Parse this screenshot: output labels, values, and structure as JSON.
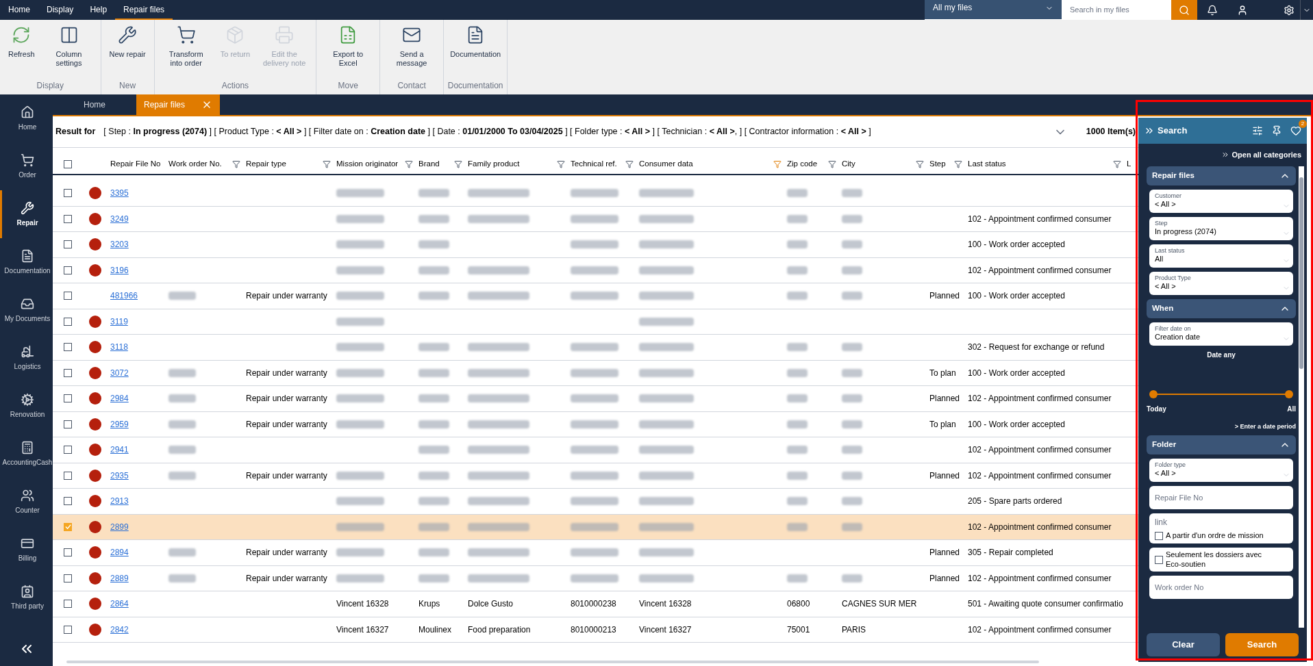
{
  "menu": [
    {
      "label": "Home",
      "selected": false
    },
    {
      "label": "Display",
      "selected": false
    },
    {
      "label": "Help",
      "selected": false
    },
    {
      "label": "Repair files",
      "selected": true
    }
  ],
  "top_right": {
    "scope": "All my files",
    "search_placeholder": "Search in my files"
  },
  "ribbon": [
    {
      "group": "Display",
      "buttons": [
        {
          "label": "Refresh",
          "disabled": false
        },
        {
          "label": "Column settings",
          "disabled": false
        }
      ]
    },
    {
      "group": "New",
      "buttons": [
        {
          "label": "New repair",
          "disabled": false
        }
      ]
    },
    {
      "group": "Actions",
      "buttons": [
        {
          "label": "Transform into order",
          "disabled": false
        },
        {
          "label": "To return",
          "disabled": true
        },
        {
          "label": "Edit the delivery note",
          "disabled": true
        }
      ]
    },
    {
      "group": "Move",
      "buttons": [
        {
          "label": "Export to Excel",
          "disabled": false
        }
      ]
    },
    {
      "group": "Contact",
      "buttons": [
        {
          "label": "Send a message",
          "disabled": false
        }
      ]
    },
    {
      "group": "Documentation",
      "buttons": [
        {
          "label": "Documentation",
          "disabled": false
        }
      ]
    }
  ],
  "doc_tabs": [
    {
      "label": "Home",
      "selected": false
    },
    {
      "label": "Repair files",
      "selected": true
    }
  ],
  "sidebar": [
    {
      "label": "Home",
      "selected": false
    },
    {
      "label": "Order",
      "selected": false
    },
    {
      "label": "Repair",
      "selected": true
    },
    {
      "label": "Documentation",
      "selected": false
    },
    {
      "label": "My Documents",
      "selected": false
    },
    {
      "label": "Logistics",
      "selected": false
    },
    {
      "label": "Renovation",
      "selected": false
    },
    {
      "label": "AccountingCash",
      "selected": false
    },
    {
      "label": "Counter",
      "selected": false
    },
    {
      "label": "Billing",
      "selected": false
    },
    {
      "label": "Third party",
      "selected": false
    }
  ],
  "filter_summary": {
    "label": "Result for",
    "text": "[ Step : **In progress (2074)** ]  [ Product Type : **< All >** ]  [ Filter date on : **Creation date** ]  [ Date : **01/01/2000 To 03/04/2025** ]  [ Folder type : **< All >** ]  [ Technician : **< All >**, ]  [ Contractor information : **< All >** ]",
    "count": "1000 Item(s)"
  },
  "table": {
    "all_selected": false,
    "columns": [
      {
        "label": "Repair File No"
      },
      {
        "label": "Work order No.",
        "filtered": false
      },
      {
        "label": "Repair type",
        "filtered": false
      },
      {
        "label": "Mission originator",
        "filtered": false
      },
      {
        "label": "Brand",
        "filtered": false
      },
      {
        "label": "Family product",
        "filtered": false
      },
      {
        "label": "Technical ref.",
        "filtered": false
      },
      {
        "label": "Consumer data",
        "filtered": true
      },
      {
        "label": "Zip code",
        "filtered": false
      },
      {
        "label": "City",
        "filtered": false
      },
      {
        "label": "Step",
        "filtered": false
      },
      {
        "label": "Last status",
        "filtered": false
      },
      {
        "label": "L"
      }
    ],
    "rows": [
      {
        "file_no": "3395",
        "alert": true,
        "selected": false,
        "mission": {
          "kind": "blurred"
        },
        "brand": {
          "kind": "blurred"
        },
        "family": {
          "kind": "blurred"
        },
        "tech_ref": {
          "kind": "blurred"
        },
        "consumer": {
          "kind": "blurred"
        },
        "zip": {
          "kind": "blurred"
        },
        "city": {
          "kind": "blurred"
        }
      },
      {
        "file_no": "3249",
        "alert": true,
        "selected": false,
        "mission": {
          "kind": "blurred"
        },
        "brand": {
          "kind": "blurred"
        },
        "family": {
          "kind": "blurred"
        },
        "tech_ref": {
          "kind": "blurred"
        },
        "consumer": {
          "kind": "blurred"
        },
        "zip": {
          "kind": "blurred"
        },
        "city": {
          "kind": "blurred"
        },
        "status": "102 - Appointment confirmed consumer"
      },
      {
        "file_no": "3203",
        "alert": true,
        "selected": false,
        "mission": {
          "kind": "blurred"
        },
        "brand": {
          "kind": "blurred"
        },
        "tech_ref": {
          "kind": "blurred"
        },
        "consumer": {
          "kind": "blurred"
        },
        "zip": {
          "kind": "blurred"
        },
        "city": {
          "kind": "blurred"
        },
        "status": "100 - Work order accepted"
      },
      {
        "file_no": "3196",
        "alert": true,
        "selected": false,
        "mission": {
          "kind": "blurred"
        },
        "brand": {
          "kind": "blurred"
        },
        "family": {
          "kind": "blurred"
        },
        "tech_ref": {
          "kind": "blurred"
        },
        "consumer": {
          "kind": "blurred"
        },
        "zip": {
          "kind": "blurred"
        },
        "city": {
          "kind": "blurred"
        },
        "status": "102 - Appointment confirmed consumer"
      },
      {
        "file_no": "481966",
        "alert": false,
        "selected": false,
        "work_order": {
          "kind": "blurred"
        },
        "repair_type": "Repair under warranty",
        "mission": {
          "kind": "blurred"
        },
        "brand": {
          "kind": "blurred"
        },
        "family": {
          "kind": "blurred"
        },
        "tech_ref": {
          "kind": "blurred"
        },
        "consumer": {
          "kind": "blurred"
        },
        "zip": {
          "kind": "blurred"
        },
        "city": {
          "kind": "blurred"
        },
        "step": "Planned",
        "status": "100 - Work order accepted"
      },
      {
        "file_no": "3119",
        "alert": true,
        "selected": false,
        "mission": {
          "kind": "blurred"
        },
        "consumer": {
          "kind": "blurred"
        }
      },
      {
        "file_no": "3118",
        "alert": true,
        "selected": false,
        "mission": {
          "kind": "blurred"
        },
        "brand": {
          "kind": "blurred"
        },
        "family": {
          "kind": "blurred"
        },
        "tech_ref": {
          "kind": "blurred"
        },
        "consumer": {
          "kind": "blurred"
        },
        "zip": {
          "kind": "blurred"
        },
        "city": {
          "kind": "blurred"
        },
        "status": "302 - Request for exchange or refund"
      },
      {
        "file_no": "3072",
        "alert": true,
        "selected": false,
        "work_order": {
          "kind": "blurred"
        },
        "repair_type": "Repair under warranty",
        "mission": {
          "kind": "blurred"
        },
        "brand": {
          "kind": "blurred"
        },
        "family": {
          "kind": "blurred"
        },
        "tech_ref": {
          "kind": "blurred"
        },
        "consumer": {
          "kind": "blurred"
        },
        "zip": {
          "kind": "blurred"
        },
        "city": {
          "kind": "blurred"
        },
        "step": "To plan",
        "status": "100 - Work order accepted"
      },
      {
        "file_no": "2984",
        "alert": true,
        "selected": false,
        "work_order": {
          "kind": "blurred"
        },
        "repair_type": "Repair under warranty",
        "mission": {
          "kind": "blurred"
        },
        "brand": {
          "kind": "blurred"
        },
        "family": {
          "kind": "blurred"
        },
        "tech_ref": {
          "kind": "blurred"
        },
        "consumer": {
          "kind": "blurred"
        },
        "zip": {
          "kind": "blurred"
        },
        "city": {
          "kind": "blurred"
        },
        "step": "Planned",
        "status": "102 - Appointment confirmed consumer"
      },
      {
        "file_no": "2959",
        "alert": true,
        "selected": false,
        "work_order": {
          "kind": "blurred"
        },
        "repair_type": "Repair under warranty",
        "mission": {
          "kind": "blurred"
        },
        "brand": {
          "kind": "blurred"
        },
        "family": {
          "kind": "blurred"
        },
        "tech_ref": {
          "kind": "blurred"
        },
        "consumer": {
          "kind": "blurred"
        },
        "zip": {
          "kind": "blurred"
        },
        "city": {
          "kind": "blurred"
        },
        "step": "To plan",
        "status": "100 - Work order accepted"
      },
      {
        "file_no": "2941",
        "alert": true,
        "selected": false,
        "work_order": {
          "kind": "blurred"
        },
        "brand": {
          "kind": "blurred"
        },
        "family": {
          "kind": "blurred"
        },
        "tech_ref": {
          "kind": "blurred"
        },
        "consumer": {
          "kind": "blurred"
        },
        "zip": {
          "kind": "blurred"
        },
        "city": {
          "kind": "blurred"
        },
        "status": "102 - Appointment confirmed consumer"
      },
      {
        "file_no": "2935",
        "alert": true,
        "selected": false,
        "work_order": {
          "kind": "blurred"
        },
        "repair_type": "Repair under warranty",
        "mission": {
          "kind": "blurred"
        },
        "brand": {
          "kind": "blurred"
        },
        "family": {
          "kind": "blurred"
        },
        "tech_ref": {
          "kind": "blurred"
        },
        "consumer": {
          "kind": "blurred"
        },
        "zip": {
          "kind": "blurred"
        },
        "city": {
          "kind": "blurred"
        },
        "step": "Planned",
        "status": "102 - Appointment confirmed consumer"
      },
      {
        "file_no": "2913",
        "alert": true,
        "selected": false,
        "mission": {
          "kind": "blurred"
        },
        "brand": {
          "kind": "blurred"
        },
        "family": {
          "kind": "blurred"
        },
        "tech_ref": {
          "kind": "blurred"
        },
        "consumer": {
          "kind": "blurred"
        },
        "zip": {
          "kind": "blurred"
        },
        "city": {
          "kind": "blurred"
        },
        "status": "205 - Spare parts ordered"
      },
      {
        "file_no": "2899",
        "alert": true,
        "selected": true,
        "mission": {
          "kind": "blurred"
        },
        "brand": {
          "kind": "blurred"
        },
        "family": {
          "kind": "blurred"
        },
        "tech_ref": {
          "kind": "blurred"
        },
        "consumer": {
          "kind": "blurred"
        },
        "zip": {
          "kind": "blurred"
        },
        "city": {
          "kind": "blurred"
        },
        "status": "102 - Appointment confirmed consumer"
      },
      {
        "file_no": "2894",
        "alert": true,
        "selected": false,
        "work_order": {
          "kind": "blurred"
        },
        "repair_type": "Repair under warranty",
        "mission": {
          "kind": "blurred"
        },
        "brand": {
          "kind": "blurred"
        },
        "family": {
          "kind": "blurred"
        },
        "tech_ref": {
          "kind": "blurred"
        },
        "consumer": {
          "kind": "blurred"
        },
        "step": "Planned",
        "status": "305 - Repair completed"
      },
      {
        "file_no": "2889",
        "alert": true,
        "selected": false,
        "work_order": {
          "kind": "blurred"
        },
        "repair_type": "Repair under warranty",
        "mission": {
          "kind": "blurred"
        },
        "brand": {
          "kind": "blurred"
        },
        "family": {
          "kind": "blurred"
        },
        "tech_ref": {
          "kind": "blurred"
        },
        "consumer": {
          "kind": "blurred"
        },
        "zip": {
          "kind": "blurred"
        },
        "city": {
          "kind": "blurred"
        },
        "step": "Planned",
        "status": "102 - Appointment confirmed consumer"
      },
      {
        "file_no": "2864",
        "alert": true,
        "selected": false,
        "mission": "Vincent 16328",
        "brand": "Krups",
        "family": "Dolce Gusto",
        "tech_ref": "8010000238",
        "consumer": "Vincent 16328",
        "zip": "06800",
        "city": "CAGNES SUR MER",
        "status": "501 - Awaiting quote consumer confirmatio"
      },
      {
        "file_no": "2842",
        "alert": true,
        "selected": false,
        "mission": "Vincent 16327",
        "brand": "Moulinex",
        "family": "Food preparation",
        "tech_ref": "8010000213",
        "consumer": "Vincent 16327",
        "zip": "75001",
        "city": "PARIS",
        "status": "102 - Appointment confirmed consumer"
      }
    ]
  },
  "search_panel": {
    "highlighted": true,
    "title": "Search",
    "badge": "2",
    "open_all": "Open all categories",
    "sections": [
      {
        "title": "Repair files",
        "expanded": true,
        "items": [
          {
            "kind": "select",
            "label": "Customer",
            "value": "< All >"
          },
          {
            "kind": "select",
            "label": "Step",
            "value": "In progress (2074)"
          },
          {
            "kind": "select",
            "label": "Last status",
            "value": "All"
          },
          {
            "kind": "select",
            "label": "Product Type",
            "value": "< All >"
          }
        ]
      },
      {
        "title": "When",
        "expanded": true,
        "items": [
          {
            "kind": "select",
            "label": "Filter date on",
            "value": "Creation date"
          },
          {
            "kind": "range",
            "caption": "Date any",
            "min_label": "Today",
            "max_label": "All",
            "level": 1,
            "link": "> Enter a date period"
          }
        ]
      },
      {
        "title": "Folder",
        "expanded": true,
        "items": [
          {
            "kind": "select",
            "label": "Folder type",
            "value": "< All >"
          },
          {
            "kind": "input",
            "placeholder": "Repair File No"
          },
          {
            "kind": "checkbox",
            "label": "link",
            "text": "A partir d'un ordre de mission",
            "checked": false
          },
          {
            "kind": "checkbox",
            "text": "Seulement les dossiers avec Eco-soutien",
            "checked": false
          },
          {
            "kind": "input",
            "placeholder": "Work order No"
          }
        ]
      }
    ],
    "buttons": [
      {
        "label": "Clear",
        "kind": "secondary"
      },
      {
        "label": "Search",
        "kind": "primary"
      }
    ]
  }
}
